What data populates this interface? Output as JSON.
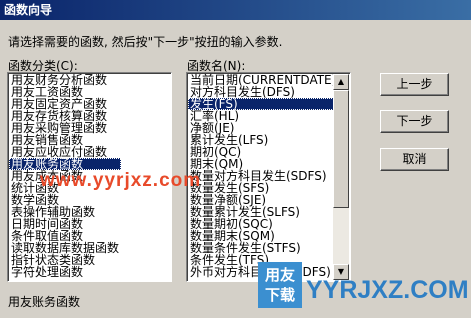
{
  "dialog": {
    "title": "函数向导",
    "prompt": "请选择需要的函数, 然后按\"下一步\"按扭的输入参数.",
    "category_label": "函数分类(C):",
    "function_label": "函数名(N):",
    "status_text": "用友账务函数"
  },
  "categories": [
    "用友财务分析函数",
    "用友工资函数",
    "用友固定资产函数",
    "用友存货核算函数",
    "用友采购管理函数",
    "用友销售函数",
    "用友应收应付函数",
    "用友账务函数",
    "用友成本函数",
    "统计函数",
    "数学函数",
    "表操作辅助函数",
    "日期时间函数",
    "条件取值函数",
    "读取数据库数据函数",
    "指针状态类函数",
    "字符处理函数"
  ],
  "selected_category": "用友账务函数",
  "functions": [
    "当前日期(CURRENTDATE)",
    "对方科目发生(DFS)",
    "发生(FS)",
    "汇率(HL)",
    "净额(JE)",
    "累计发生(LFS)",
    "期初(QC)",
    "期末(QM)",
    "数量对方科目发生(SDFS)",
    "数量发生(SFS)",
    "数量净额(SJE)",
    "数量累计发生(SLFS)",
    "数量期初(SQC)",
    "数量期末(SQM)",
    "数量条件发生(STFS)",
    "条件发生(TFS)",
    "外币对方科目发生(WDFS)"
  ],
  "selected_function": "发生(FS)",
  "buttons": {
    "prev": "上一步",
    "next": "下一步",
    "cancel": "取消"
  },
  "watermark": {
    "url": "www.yyrjxz.com",
    "logo_line1": "用友",
    "logo_line2": "下载",
    "site": "YYRJXZ.COM"
  }
}
